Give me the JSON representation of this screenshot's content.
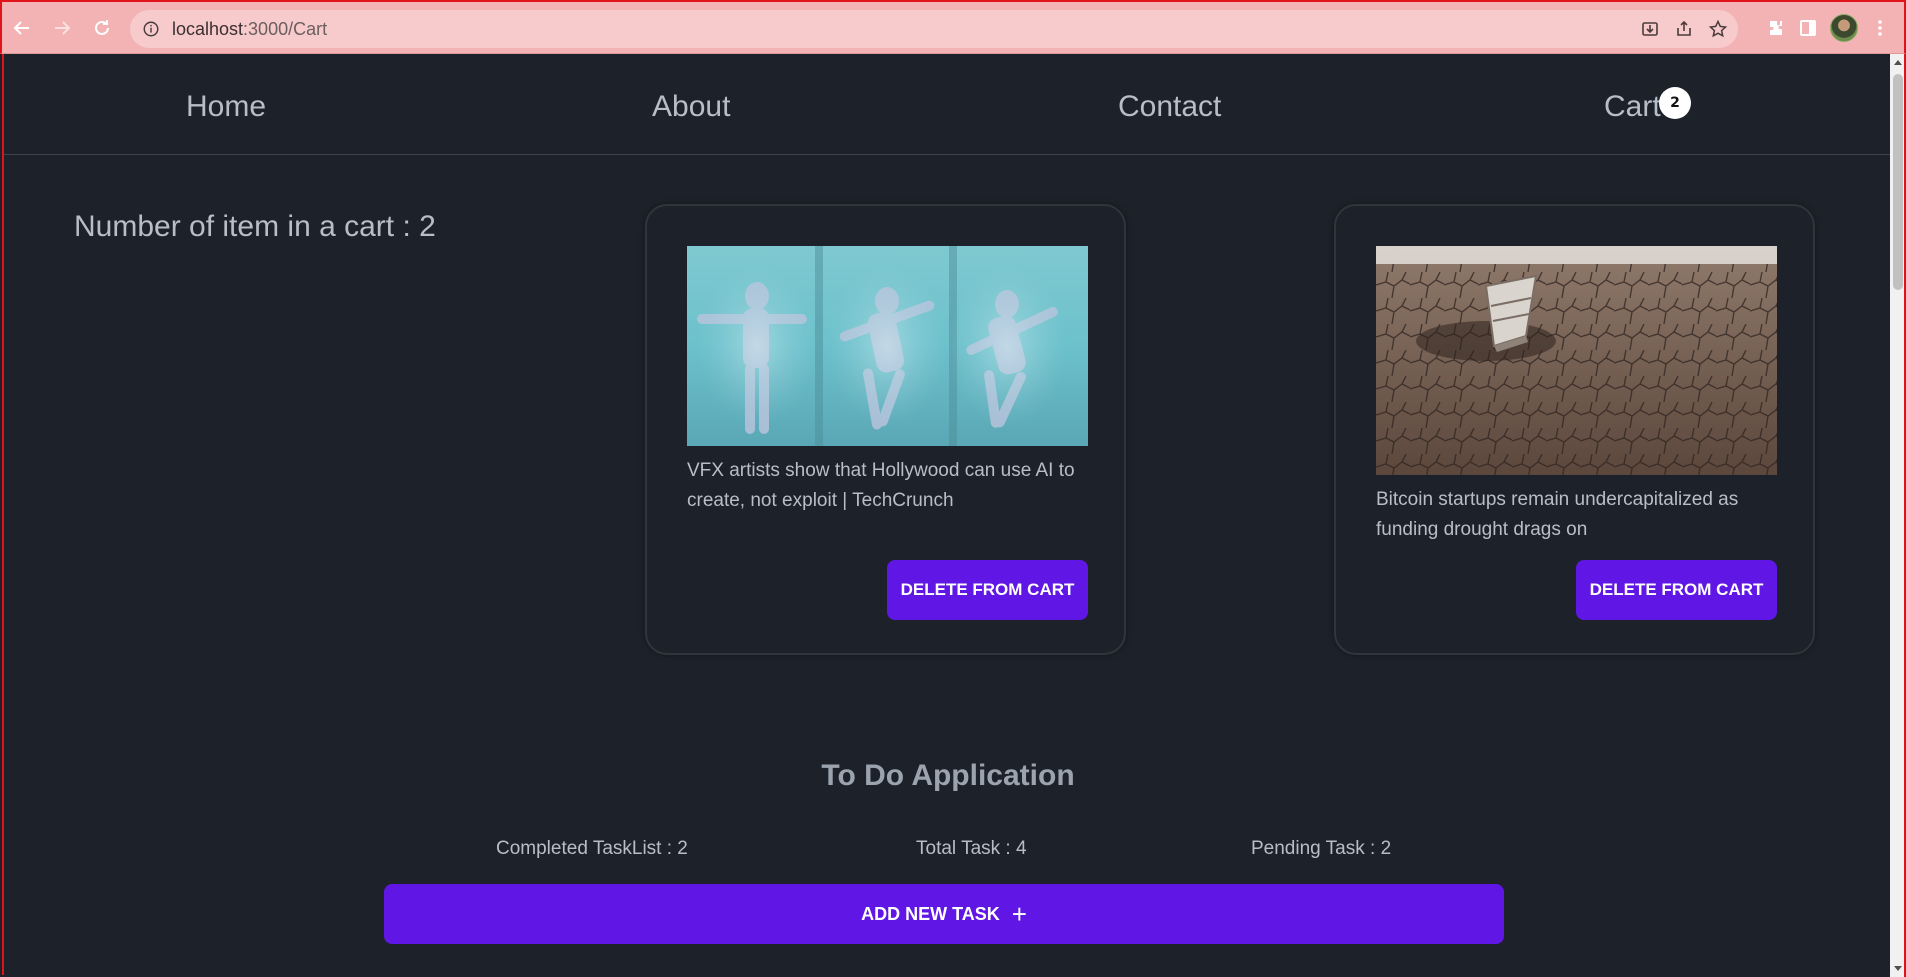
{
  "browser": {
    "url_host": "localhost",
    "url_path": ":3000/Cart"
  },
  "nav": {
    "home": "Home",
    "about": "About",
    "contact": "Contact",
    "cart": "Cart",
    "cart_badge": "2"
  },
  "cart": {
    "count_text": "Number of item in a cart : 2",
    "items": [
      {
        "title": "VFX artists show that Hollywood can use AI to create, not exploit | TechCrunch",
        "delete_label": "DELETE FROM CART"
      },
      {
        "title": "Bitcoin startups remain undercapitalized as funding drought drags on",
        "delete_label": "DELETE FROM CART"
      }
    ]
  },
  "todo": {
    "title": "To Do Application",
    "completed": "Completed TaskList : 2",
    "total": "Total Task : 4",
    "pending": "Pending Task : 2",
    "add_label": "ADD NEW TASK",
    "add_icon": "+"
  },
  "colors": {
    "accent": "#6017e6",
    "background": "#1d2129",
    "chrome": "#f3b3b5"
  }
}
